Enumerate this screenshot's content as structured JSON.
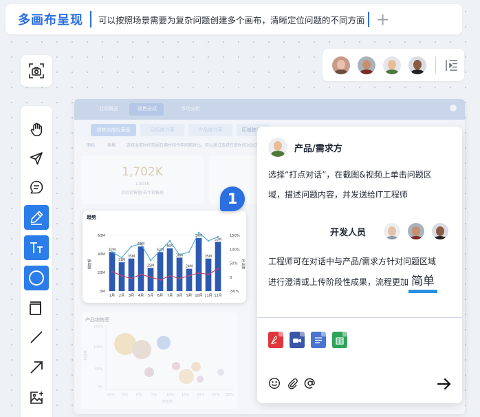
{
  "header": {
    "title": "多画布呈现",
    "description": "可以按照场景需要为复杂问题创建多个画布，清晰定位问题的不同方面",
    "add_label": "+"
  },
  "dashboard": {
    "top_tabs": [
      "业绩概览",
      "销售达成",
      "市场分析"
    ],
    "sub_tabs": [
      "销售达成仪表盘",
      "目标统计表",
      "产品统计表",
      "区域统计表"
    ],
    "filter_row": [
      "图标",
      "表格",
      "选择当前时间范围日期并和今年同期对比，可以通过选择任意时间对比区域，进行维度分析。"
    ],
    "kpi_value": "1,702K",
    "kpi_sub": "1,801K",
    "kpi_caption": "实际销售额/去年销售额",
    "sales_chart_title": "产品销售图",
    "sales_x_ticks": [
      "-10%",
      "-5%",
      "0%",
      "5%",
      "10%",
      "15%",
      "20%",
      "25%",
      "30%"
    ],
    "sales_y_ticks": [
      "150%",
      "100%",
      "50%",
      "0%"
    ],
    "sales_xlabel": "增长率",
    "sales_ylabel": "利润率"
  },
  "chart_data": {
    "type": "bar",
    "title": "趋势",
    "categories": [
      "1月",
      "2月",
      "3月",
      "4月",
      "5月",
      "6月",
      "7月",
      "8月",
      "9月",
      "10月",
      "11月",
      "12月"
    ],
    "series": [
      {
        "name": "销售额",
        "type": "bar",
        "values": [
          42,
          31,
          35,
          48,
          25,
          42,
          46,
          36,
          24,
          57,
          35,
          53
        ]
      },
      {
        "name": "增长率",
        "type": "line",
        "values": [
          90,
          70,
          110,
          120,
          60,
          95,
          130,
          80,
          90,
          160,
          130,
          145
        ]
      },
      {
        "name": "利润率",
        "type": "line",
        "values": [
          20,
          5,
          -5,
          10,
          0,
          -10,
          5,
          -5,
          5,
          15,
          10,
          30
        ]
      }
    ],
    "bar_labels": [
      "42M",
      "31M",
      "35M",
      "48M",
      "25M",
      "42M",
      "46M",
      "36M",
      "24M",
      "57M",
      "35M",
      "53M"
    ],
    "y_ticks_left": [
      "60M",
      "40M",
      "20M",
      "0M"
    ],
    "y_ticks_right": [
      "150%",
      "100%",
      "50%",
      "0",
      "-50%"
    ],
    "ylim_left": [
      0,
      60
    ],
    "ylim_right": [
      -50,
      150
    ],
    "ylabel_left": "销售额",
    "ylabel_right": "利润率",
    "colors": {
      "bar": "#2d5ab0",
      "line_growth": "#5aa9d8",
      "line_margin": "#c2466b"
    }
  },
  "badge": {
    "number": "1"
  },
  "chat": {
    "role_product": "产品/需求方",
    "msg1_line1": "选择“打点对话”，在截图&视频上单击问题区",
    "msg1_line2": "域，描述问题内容，并发送给IT工程师",
    "role_dev": "开发人员",
    "msg2_line1": "工程师可在对话中与产品/需求方针对问题区域",
    "msg2_line2": "进行澄清或上传阶段性成果，流程更加",
    "msg2_emph": "简单",
    "files": [
      "pdf-file",
      "video-file",
      "doc-file",
      "sheet-file"
    ],
    "tools": [
      "emoji-icon",
      "attachment-icon",
      "mention-icon"
    ]
  },
  "colors": {
    "accent": "#2b6fe0",
    "active_tool": "#2b7de9",
    "pdf": "#e0353b",
    "video": "#3a56a8",
    "doc": "#4a74cf",
    "sheet": "#2ea35a"
  }
}
